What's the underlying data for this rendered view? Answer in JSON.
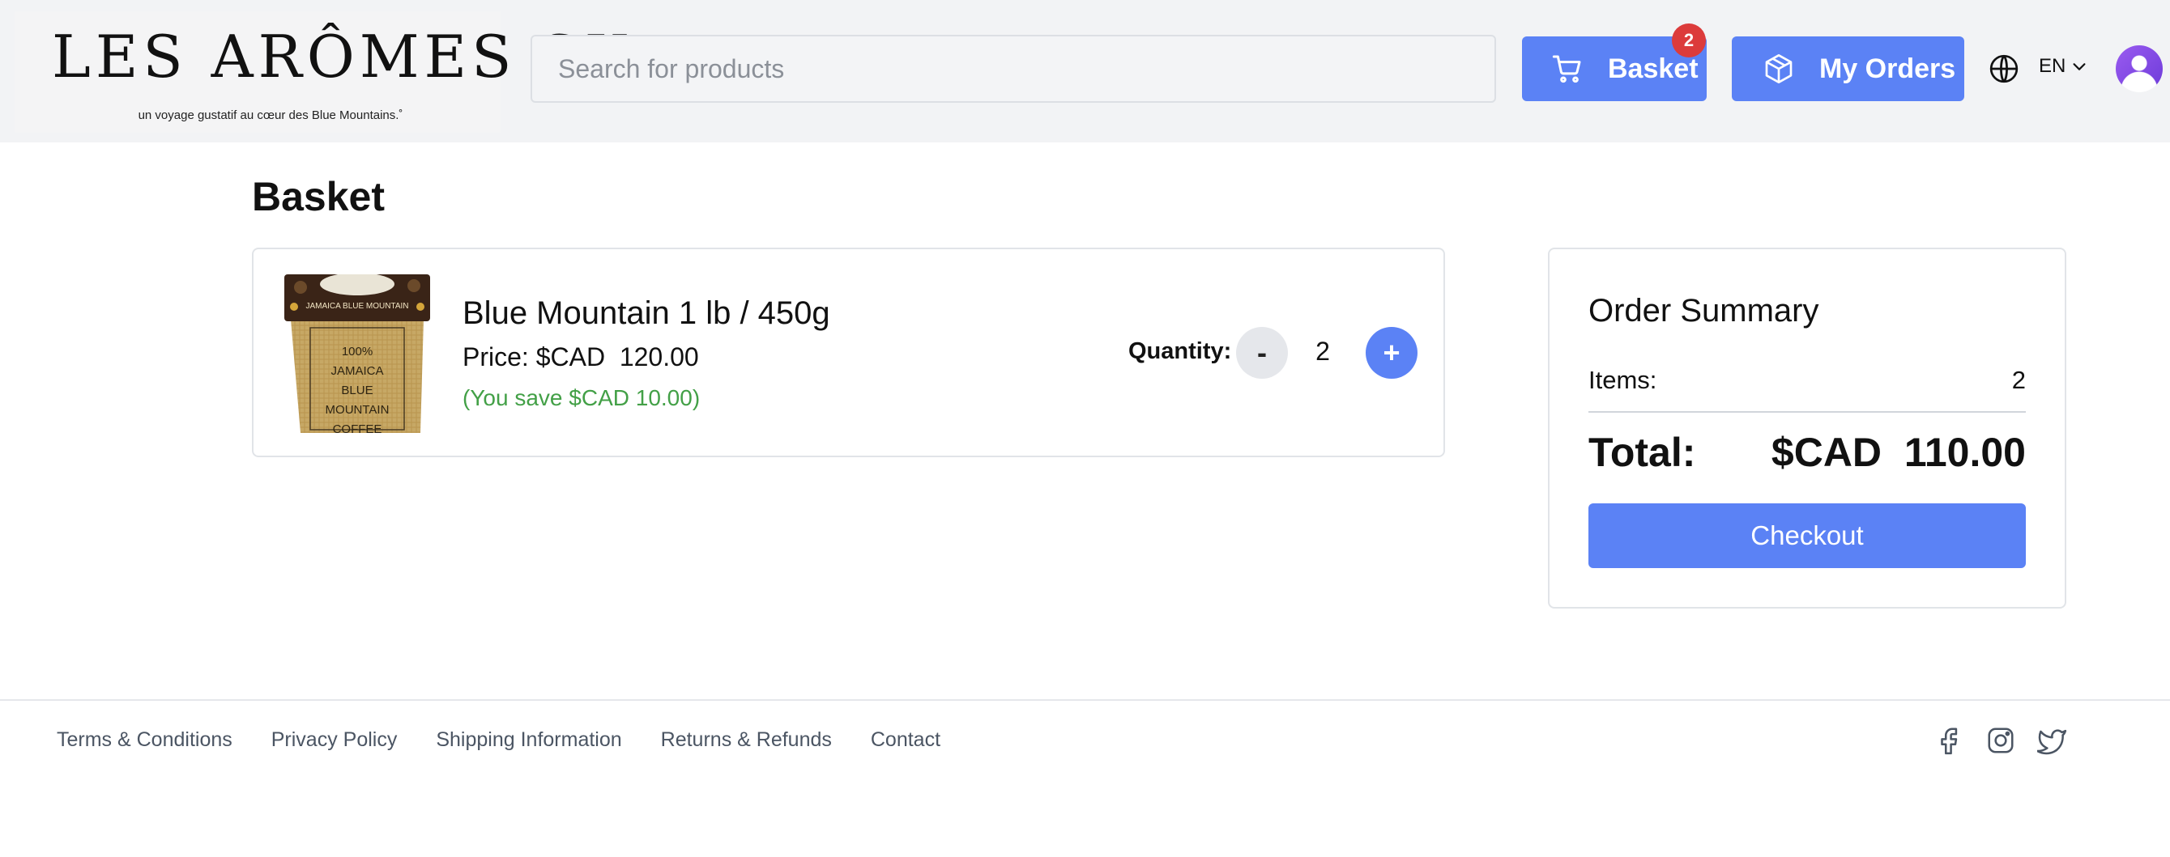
{
  "brand": {
    "name": "LES ARÔMES SK",
    "tagline": "un voyage gustatif au cœur des Blue Mountains.˚"
  },
  "header": {
    "search_placeholder": "Search for products",
    "basket_label": "Basket",
    "basket_count": "2",
    "orders_label": "My Orders",
    "language": "EN",
    "icons": [
      "cart-icon",
      "package-icon",
      "globe-icon",
      "chevron-down-icon",
      "user-avatar"
    ]
  },
  "main": {
    "title": "Basket",
    "items": [
      {
        "name": "Blue Mountain 1 lb / 450g",
        "price": "Price: $CAD  120.00",
        "savings": "(You save $CAD 10.00)",
        "quantity_label": "Quantity:",
        "quantity": "2",
        "decrement_label": "-",
        "increment_label": "+",
        "image": {
          "band_text": "JAMAICA BLUE MOUNTAIN",
          "bag_text": [
            "100%",
            "JAMAICA",
            "BLUE",
            "MOUNTAIN",
            "COFFEE"
          ]
        }
      }
    ]
  },
  "summary": {
    "title": "Order Summary",
    "items_label": "Items:",
    "items_value": "2",
    "total_label": "Total:",
    "total_value": "$CAD  110.00",
    "checkout_label": "Checkout"
  },
  "footer": {
    "links": [
      "Terms & Conditions",
      "Privacy Policy",
      "Shipping Information",
      "Returns & Refunds",
      "Contact"
    ],
    "social": [
      "facebook-icon",
      "instagram-icon",
      "twitter-icon"
    ]
  },
  "colors": {
    "accent": "#5b82f5",
    "badge": "#dc3b3b",
    "savings": "#43a047",
    "header_bg": "#f2f3f5"
  }
}
